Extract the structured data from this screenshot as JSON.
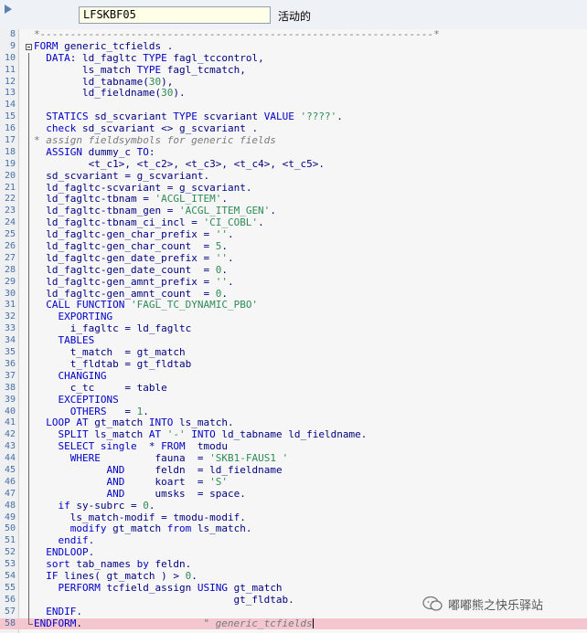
{
  "header": {
    "program_name": "LFSKBF05",
    "status": "活动的"
  },
  "editor": {
    "lines": [
      {
        "n": "8",
        "code": "*-----------------------------------------------------------------*"
      },
      {
        "n": "9",
        "code": "FORM generic_tcfields ."
      },
      {
        "n": "10",
        "code": "  DATA: ld_fagltc TYPE fagl_tccontrol,"
      },
      {
        "n": "11",
        "code": "        ls_match TYPE fagl_tcmatch,"
      },
      {
        "n": "12",
        "code": "        ld_tabname(30),"
      },
      {
        "n": "13",
        "code": "        ld_fieldname(30)."
      },
      {
        "n": "14",
        "code": ""
      },
      {
        "n": "15",
        "code": "  STATICS sd_scvariant TYPE scvariant VALUE '????'."
      },
      {
        "n": "16",
        "code": "  check sd_scvariant <> g_scvariant ."
      },
      {
        "n": "17",
        "code": "* assign fieldsymbols for generic fields"
      },
      {
        "n": "18",
        "code": "  ASSIGN dummy_c TO:"
      },
      {
        "n": "19",
        "code": "         <t_c1>, <t_c2>, <t_c3>, <t_c4>, <t_c5>."
      },
      {
        "n": "20",
        "code": "  sd_scvariant = g_scvariant."
      },
      {
        "n": "21",
        "code": "  ld_fagltc-scvariant = g_scvariant."
      },
      {
        "n": "22",
        "code": "  ld_fagltc-tbnam = 'ACGL_ITEM'."
      },
      {
        "n": "23",
        "code": "  ld_fagltc-tbnam_gen = 'ACGL_ITEM_GEN'."
      },
      {
        "n": "24",
        "code": "  ld_fagltc-tbnam_ci_incl = 'CI_COBL'."
      },
      {
        "n": "25",
        "code": "  ld_fagltc-gen_char_prefix = ''."
      },
      {
        "n": "26",
        "code": "  ld_fagltc-gen_char_count  = 5."
      },
      {
        "n": "27",
        "code": "  ld_fagltc-gen_date_prefix = ''."
      },
      {
        "n": "28",
        "code": "  ld_fagltc-gen_date_count  = 0."
      },
      {
        "n": "29",
        "code": "  ld_fagltc-gen_amnt_prefix = ''."
      },
      {
        "n": "30",
        "code": "  ld_fagltc-gen_amnt_count  = 0."
      },
      {
        "n": "31",
        "code": "  CALL FUNCTION 'FAGL_TC_DYNAMIC_PBO'"
      },
      {
        "n": "32",
        "code": "    EXPORTING"
      },
      {
        "n": "33",
        "code": "      i_fagltc = ld_fagltc"
      },
      {
        "n": "34",
        "code": "    TABLES"
      },
      {
        "n": "35",
        "code": "      t_match  = gt_match"
      },
      {
        "n": "36",
        "code": "      t_fldtab = gt_fldtab"
      },
      {
        "n": "37",
        "code": "    CHANGING"
      },
      {
        "n": "38",
        "code": "      c_tc     = table"
      },
      {
        "n": "39",
        "code": "    EXCEPTIONS"
      },
      {
        "n": "40",
        "code": "      OTHERS   = 1."
      },
      {
        "n": "41",
        "code": "  LOOP AT gt_match INTO ls_match."
      },
      {
        "n": "42",
        "code": "    SPLIT ls_match AT '-' INTO ld_tabname ld_fieldname."
      },
      {
        "n": "43",
        "code": "    SELECT single  * FROM  tmodu"
      },
      {
        "n": "44",
        "code": "      WHERE         fauna  = 'SKB1-FAUS1 '"
      },
      {
        "n": "45",
        "code": "            AND     feldn  = ld_fieldname"
      },
      {
        "n": "46",
        "code": "            AND     koart  = 'S'"
      },
      {
        "n": "47",
        "code": "            AND     umsks  = space."
      },
      {
        "n": "48",
        "code": "    if sy-subrc = 0."
      },
      {
        "n": "49",
        "code": "      ls_match-modif = tmodu-modif."
      },
      {
        "n": "50",
        "code": "      modify gt_match from ls_match."
      },
      {
        "n": "51",
        "code": "    endif."
      },
      {
        "n": "52",
        "code": "  ENDLOOP."
      },
      {
        "n": "53",
        "code": "  sort tab_names by feldn."
      },
      {
        "n": "54",
        "code": "  IF lines( gt_match ) > 0."
      },
      {
        "n": "55",
        "code": "    PERFORM tcfield_assign USING gt_match"
      },
      {
        "n": "56",
        "code": "                                 gt_fldtab."
      },
      {
        "n": "57",
        "code": "  ENDIF."
      },
      {
        "n": "58",
        "code": "ENDFORM.                    \" generic_tcfields"
      }
    ]
  },
  "watermark": {
    "text": "嘟嘟熊之快乐驿站"
  },
  "colors": {
    "keyword": "#0000c8",
    "identifier": "#000080",
    "string": "#2e8b57",
    "comment": "#7a7a7a",
    "highlight_line": "#f4c6cf"
  }
}
